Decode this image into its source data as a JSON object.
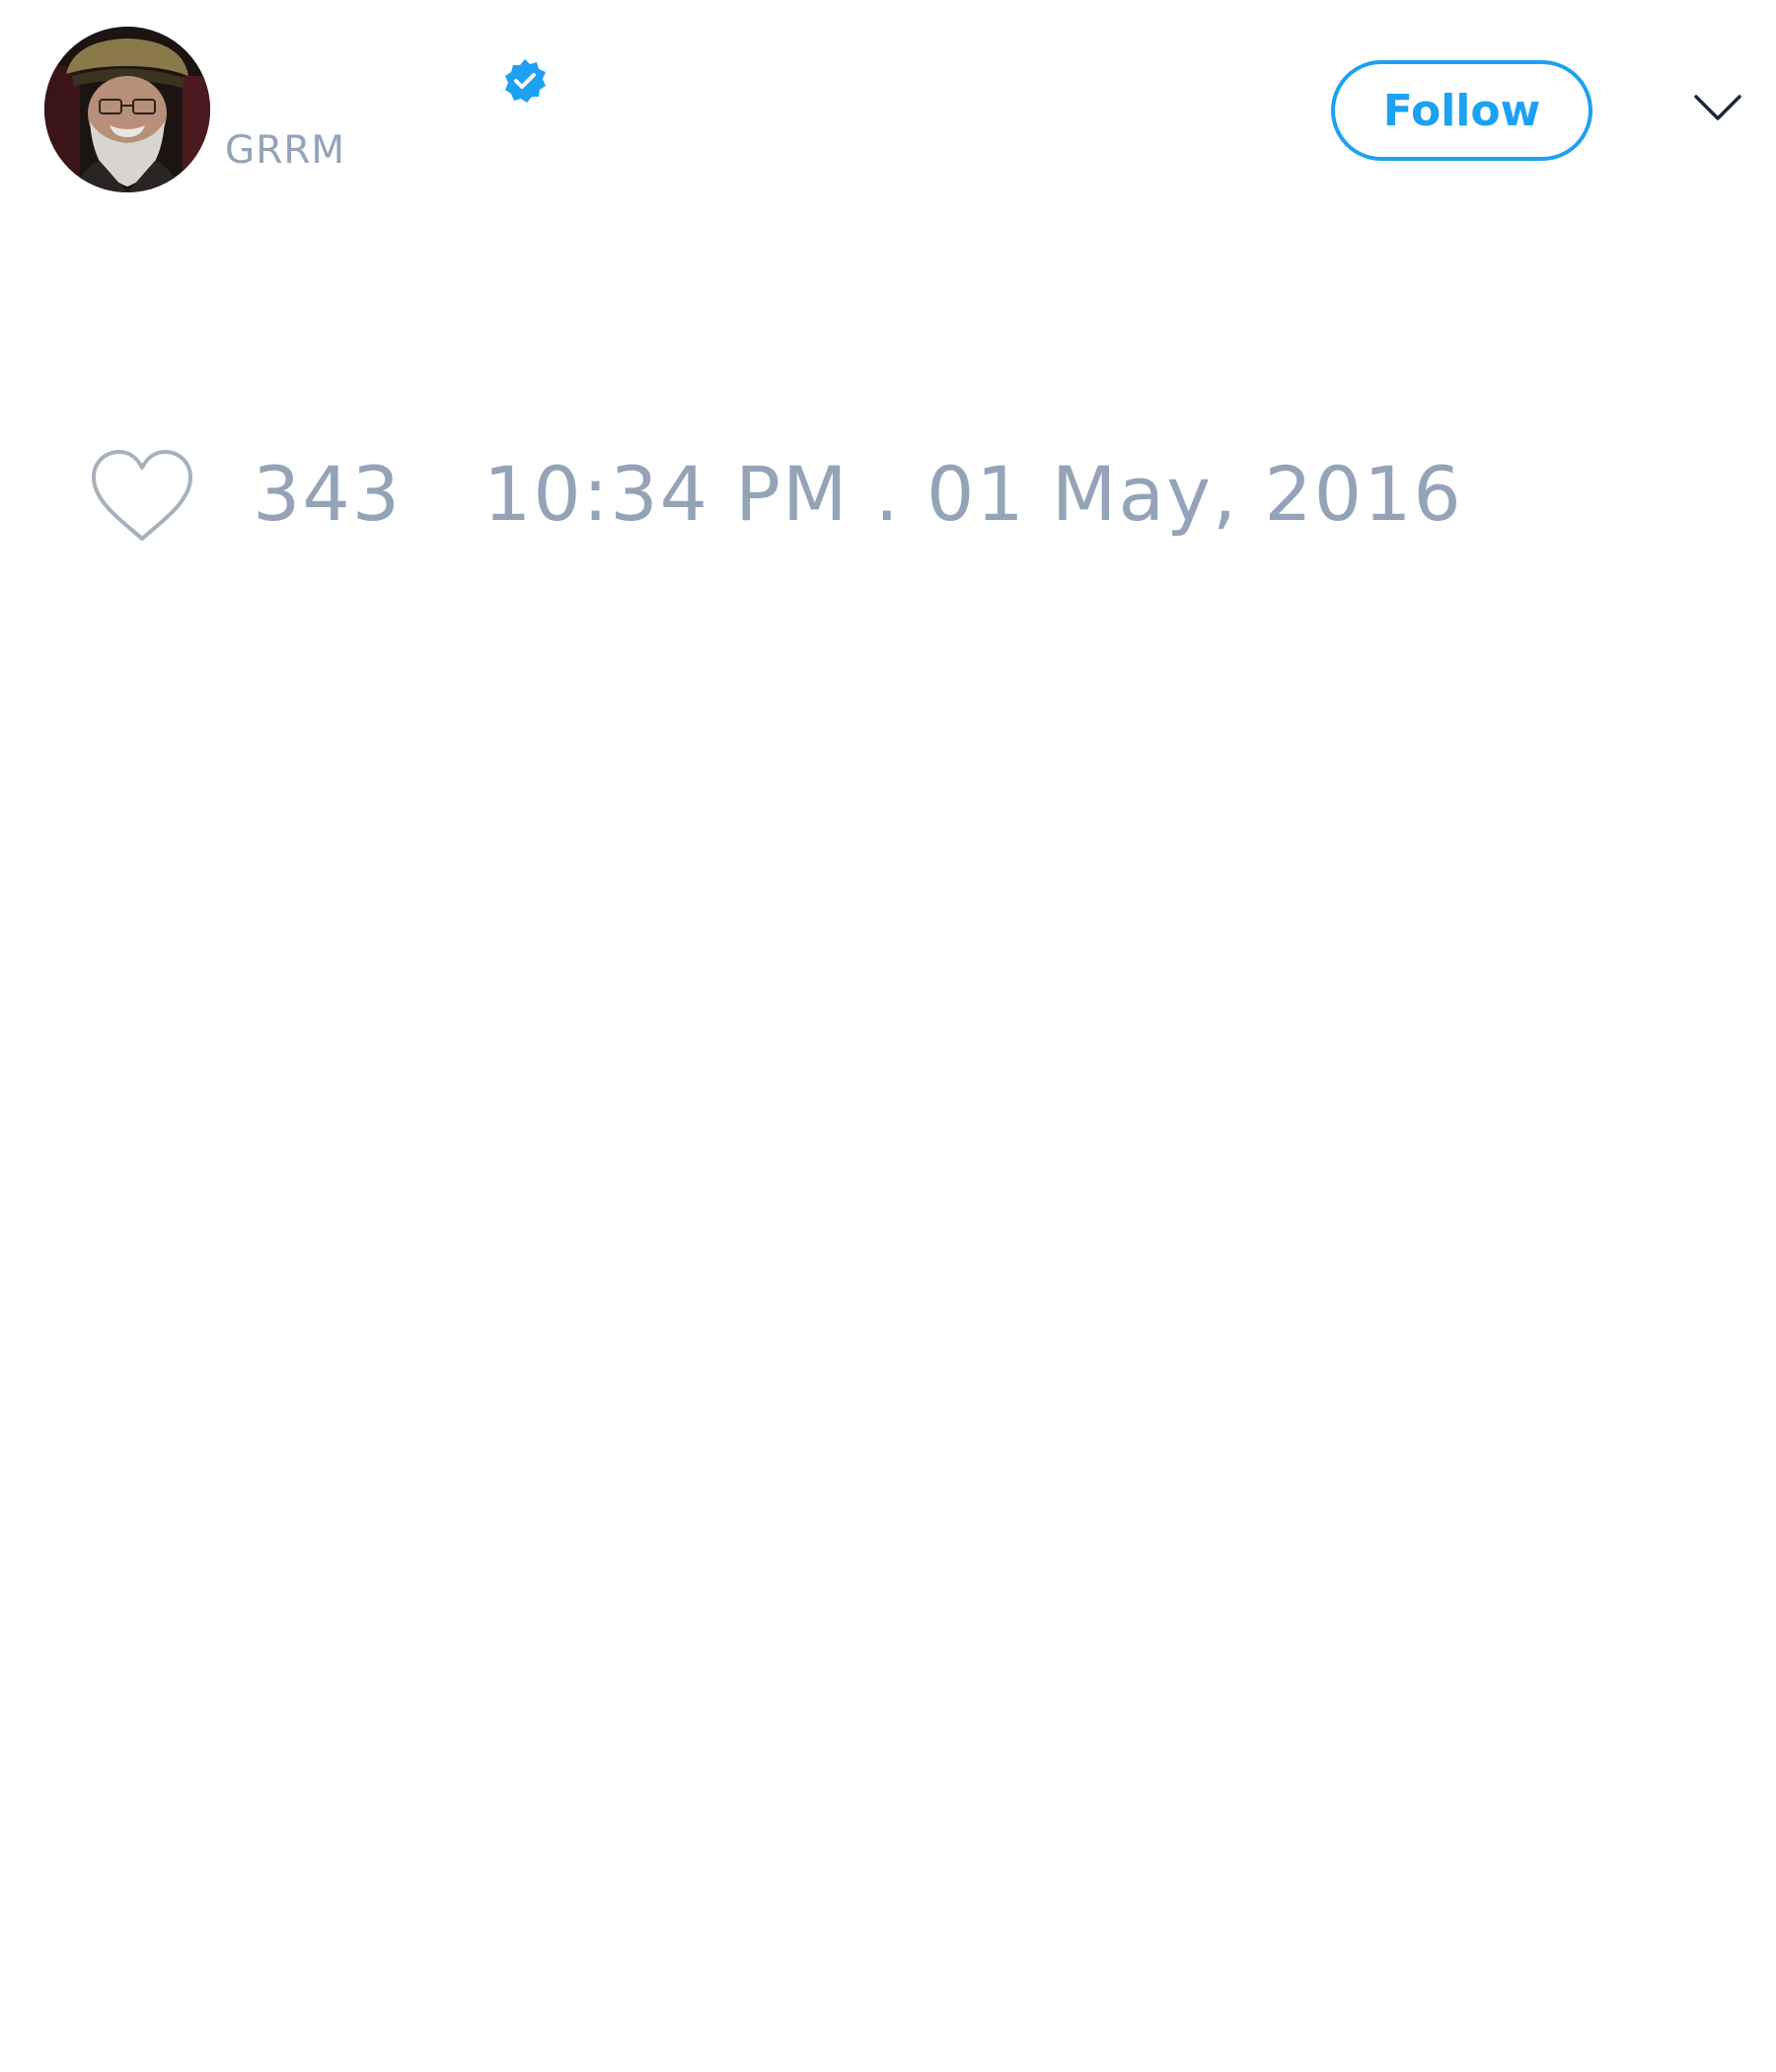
{
  "tweet": {
    "author": {
      "handle": "GRRM",
      "verified": true,
      "avatar_icon": "user-avatar"
    },
    "follow_label": "Follow",
    "menu_icon": "chevron-down-icon",
    "likes": "343",
    "timestamp": "10:34 PM . 01 May, 2016"
  },
  "colors": {
    "accent": "#1da1f2",
    "muted_text": "#94a3b8",
    "background": "#ffffff"
  }
}
